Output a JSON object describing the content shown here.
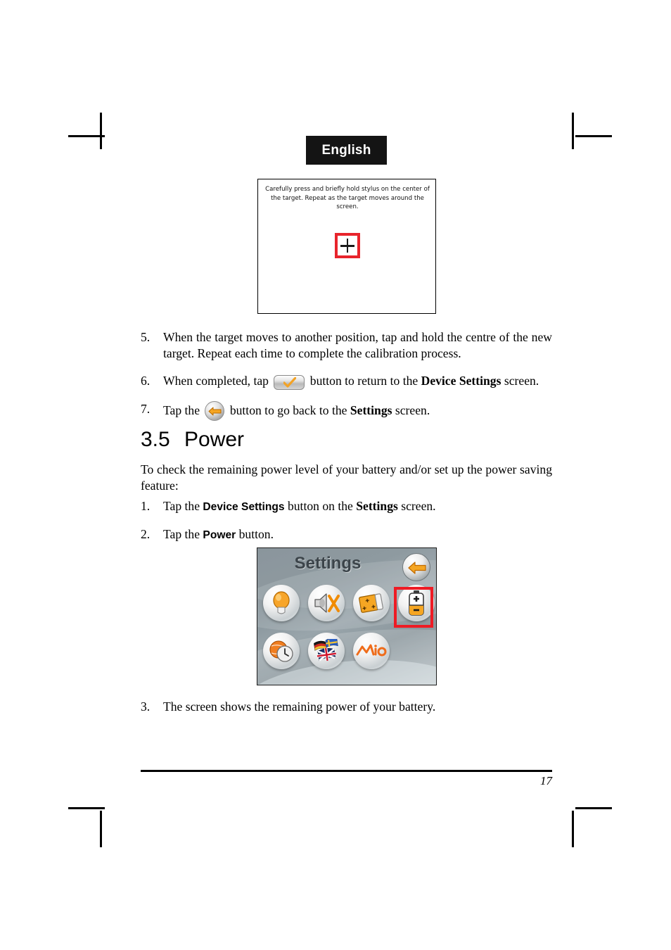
{
  "page": {
    "language_header": "English",
    "page_number": "17"
  },
  "calibration_screen": {
    "instruction": "Carefully press and briefly hold stylus on the center of the target. Repeat as the target moves around the screen.",
    "target_marker_color": "#e8242c"
  },
  "steps_calibration": [
    {
      "num": "5.",
      "parts": [
        {
          "type": "text",
          "text": "When the target moves to another position, tap and hold the centre of the new target. Repeat each time to complete the calibration process."
        }
      ]
    },
    {
      "num": "6.",
      "parts": [
        {
          "type": "text",
          "text": "When completed, tap "
        },
        {
          "type": "icon",
          "icon": "checkmark-button-icon"
        },
        {
          "type": "text",
          "text": " button to return to the "
        },
        {
          "type": "bold-serif",
          "text": "Device Settings"
        },
        {
          "type": "text",
          "text": " screen."
        }
      ]
    },
    {
      "num": "7.",
      "parts": [
        {
          "type": "text",
          "text": "Tap the "
        },
        {
          "type": "icon",
          "icon": "back-arrow-button-icon"
        },
        {
          "type": "text",
          "text": " button to go back to the "
        },
        {
          "type": "bold-serif",
          "text": "Settings"
        },
        {
          "type": "text",
          "text": " screen."
        }
      ]
    }
  ],
  "section": {
    "number": "3.5",
    "title": "Power",
    "intro": "To check the remaining power level of your battery and/or set up the power saving feature:"
  },
  "steps_power": [
    {
      "num": "1.",
      "parts": [
        {
          "type": "text",
          "text": "Tap the "
        },
        {
          "type": "bold-sans",
          "text": "Device Settings"
        },
        {
          "type": "text",
          "text": " button on the "
        },
        {
          "type": "bold-serif",
          "text": "Settings"
        },
        {
          "type": "text",
          "text": " screen."
        }
      ]
    },
    {
      "num": "2.",
      "parts": [
        {
          "type": "text",
          "text": "Tap the "
        },
        {
          "type": "bold-sans",
          "text": "Power"
        },
        {
          "type": "text",
          "text": " button."
        }
      ]
    },
    {
      "num": "3.",
      "parts": [
        {
          "type": "text",
          "text": "The screen shows the remaining power of your battery."
        }
      ]
    }
  ],
  "settings_screen": {
    "title": "Settings",
    "back_button": "back-arrow-button-icon",
    "highlight_color": "#ee1b24",
    "highlighted_item": "power",
    "items": [
      {
        "name": "backlight",
        "icon": "light-bulb-icon"
      },
      {
        "name": "volume",
        "icon": "speaker-mute-icon"
      },
      {
        "name": "screen",
        "icon": "display-screen-icon"
      },
      {
        "name": "power",
        "icon": "battery-icon"
      },
      {
        "name": "time",
        "icon": "clock-globe-icon"
      },
      {
        "name": "language",
        "icon": "flags-icon"
      },
      {
        "name": "about",
        "icon": "mio-logo-icon"
      }
    ]
  }
}
